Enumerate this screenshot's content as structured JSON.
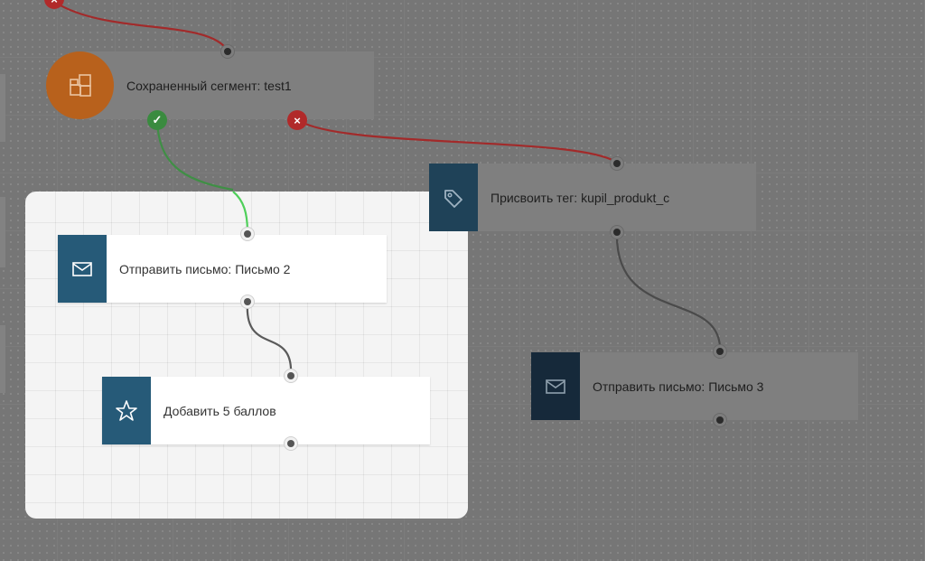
{
  "nodes": {
    "segment": {
      "label": "Сохраненный сегмент: test1",
      "icon": "segment-icon",
      "color": "#b8611c"
    },
    "tag": {
      "label": "Присвоить тег: kupil_produkt_c",
      "icon": "tag-icon",
      "color": "#1f4258"
    },
    "email2": {
      "label": "Отправить письмо: Письмо 2",
      "icon": "envelope-icon",
      "color": "#265a78"
    },
    "points": {
      "label": "Добавить 5 баллов",
      "icon": "star-icon",
      "color": "#265a78"
    },
    "email3": {
      "label": "Отправить письмо: Письмо 3",
      "icon": "envelope-icon",
      "color": "#16293a"
    }
  },
  "branches": {
    "yes": {
      "icon": "check-icon",
      "color": "#3a8b3f"
    },
    "no": {
      "icon": "x-icon",
      "color": "#b12a2a"
    }
  },
  "colors": {
    "link_yes": "#4fcf5a",
    "link_yes_dim": "#3f8f45",
    "link_no": "#a22a2a",
    "link_default": "#4a4a4a"
  }
}
